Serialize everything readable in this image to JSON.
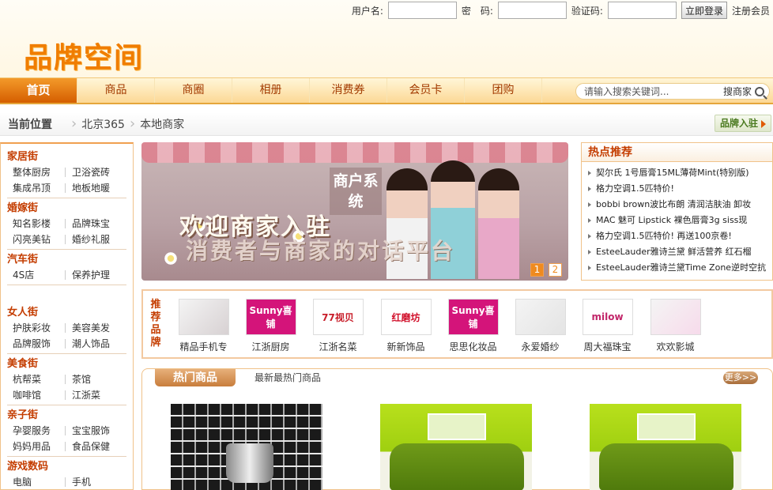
{
  "login": {
    "username_label": "用户名:",
    "password_label": "密　码:",
    "captcha_label": "验证码:",
    "login_button": "立即登录",
    "register_link": "注册会员"
  },
  "logo_text": "品牌空间",
  "nav": {
    "items": [
      "首页",
      "商品",
      "商圈",
      "相册",
      "消费券",
      "会员卡",
      "团购"
    ],
    "active_index": 0,
    "search_placeholder": "请输入搜索关键词...",
    "search_button": "搜商家"
  },
  "breadcrumb": {
    "current_label": "当前位置",
    "items": [
      "北京365",
      "本地商家"
    ],
    "brand_enter": "品牌入驻"
  },
  "sidebar": {
    "categories": [
      {
        "title": "家居街",
        "rows": [
          [
            "整体厨房",
            "卫浴瓷砖"
          ],
          [
            "集成吊顶",
            "地板地暖"
          ]
        ]
      },
      {
        "title": "婚嫁街",
        "rows": [
          [
            "知名影楼",
            "品牌珠宝"
          ],
          [
            "闪亮美钻",
            "婚纱礼服"
          ]
        ]
      },
      {
        "title": "汽车街",
        "rows": [
          [
            "4S店",
            "保养护理"
          ]
        ]
      },
      {
        "title": "女人街",
        "rows": [
          [
            "护肤彩妆",
            "美容美发"
          ],
          [
            "品牌服饰",
            "潮人饰品"
          ]
        ]
      },
      {
        "title": "美食街",
        "rows": [
          [
            "杭帮菜",
            "茶馆"
          ],
          [
            "咖啡馆",
            "江浙菜"
          ]
        ]
      },
      {
        "title": "亲子街",
        "rows": [
          [
            "孕婴服务",
            "宝宝服饰"
          ],
          [
            "妈妈用品",
            "食品保健"
          ]
        ]
      },
      {
        "title": "游戏数码",
        "rows": [
          [
            "电脑",
            "手机"
          ]
        ]
      }
    ]
  },
  "banner": {
    "title": "欢迎商家入驻",
    "subtitle": "消费者与商家的对话平台",
    "badge": "商户系统",
    "pages": [
      "1",
      "2"
    ]
  },
  "hot": {
    "title": "热点推荐",
    "items": [
      "契尔氏 1号唇膏15ML薄荷Mint(特别版)",
      "格力空调1.5匹特价!",
      "bobbi brown波比布朗 清润洁肤油 卸妆",
      "MAC 魅可 Lipstick 裸色唇膏3g siss现",
      "格力空调1.5匹特价! 再送100京卷!",
      "EsteeLauder雅诗兰黛 鲜活营养 红石榴",
      "EsteeLauder雅诗兰黛Time Zone逆时空抗"
    ]
  },
  "brands": {
    "label": "推荐品牌",
    "items": [
      {
        "name": "精品手机专",
        "logo": "",
        "color": "#3a1a22"
      },
      {
        "name": "江浙厨房",
        "logo": "Sunny喜铺",
        "color": "#d4147a"
      },
      {
        "name": "江浙名菜",
        "logo": "77视贝",
        "color": "#c81e2a"
      },
      {
        "name": "新新饰品",
        "logo": "红磨坊",
        "color": "#d10f2a"
      },
      {
        "name": "思思化妆品",
        "logo": "Sunny喜铺",
        "color": "#d4147a"
      },
      {
        "name": "永爱婚纱",
        "logo": "",
        "color": "#777777"
      },
      {
        "name": "周大福珠宝",
        "logo": "milow",
        "color": "#c2266a"
      },
      {
        "name": "欢欢影城",
        "logo": "",
        "color": "#d64a9a"
      }
    ]
  },
  "products": {
    "title": "热门商品",
    "desc": "最新最热门商品",
    "more": "更多>>"
  }
}
